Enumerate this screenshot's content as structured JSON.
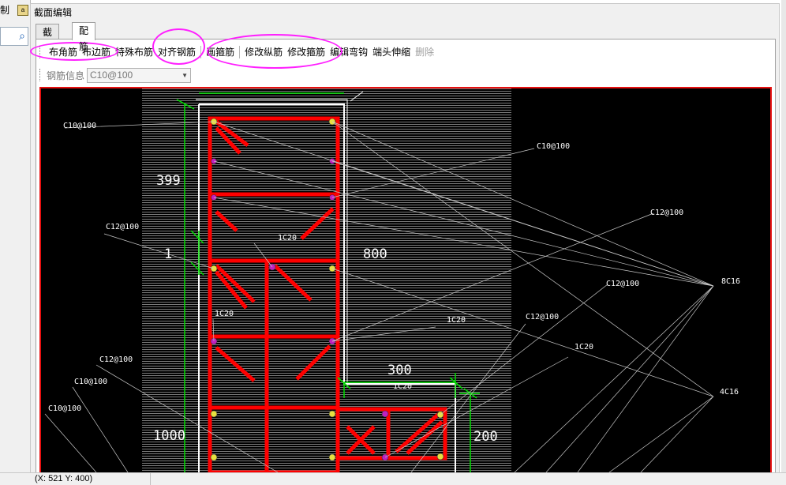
{
  "outer": {
    "left_label": "制"
  },
  "window": {
    "title": "截面编辑",
    "tabs": [
      {
        "label": "截面"
      },
      {
        "label": "配筋"
      }
    ]
  },
  "toolbar": {
    "buttons": [
      {
        "label": "布角筋",
        "enabled": true
      },
      {
        "label": "布边筋",
        "enabled": true
      },
      {
        "label": "特殊布筋",
        "enabled": true
      },
      {
        "label": "对齐钢筋",
        "enabled": true
      },
      {
        "label": "画箍筋",
        "enabled": true
      },
      {
        "label": "修改纵筋",
        "enabled": true
      },
      {
        "label": "修改箍筋",
        "enabled": true
      },
      {
        "label": "编辑弯钩",
        "enabled": true
      },
      {
        "label": "端头伸缩",
        "enabled": true
      },
      {
        "label": "删除",
        "enabled": false
      }
    ]
  },
  "rebar_info": {
    "label": "钢筋信息",
    "value": "C10@100"
  },
  "drawing": {
    "dimensions": {
      "d399": "399",
      "d1": "1",
      "d800": "800",
      "d300": "300",
      "d1000": "1000",
      "d200": "200"
    },
    "annotations": {
      "c10_100_a": "C10@100",
      "c10_100_b": "C10@100",
      "c12_100_a": "C12@100",
      "c12_100_b": "C12@100",
      "c12_100_c": "C12@100",
      "c12_100_d": "C12@100",
      "c12_100_e": "C12@100",
      "c10_100_c": "C10@100",
      "c10_100_d": "C10@100",
      "lc20_a": "1C20",
      "lc20_b": "1C20",
      "lc20_c": "1C20",
      "lc20_d": "1C20",
      "lc20_e": "1C20",
      "c16_8": "8C16",
      "c16_4": "4C16"
    },
    "colors": {
      "rebar": "#ff0000",
      "outline": "#ffffff",
      "dimension": "#00dd00",
      "bar": "#e8e040",
      "bar_purple": "#c020c0"
    }
  },
  "status": {
    "coords": "(X: 521 Y: 400)"
  }
}
